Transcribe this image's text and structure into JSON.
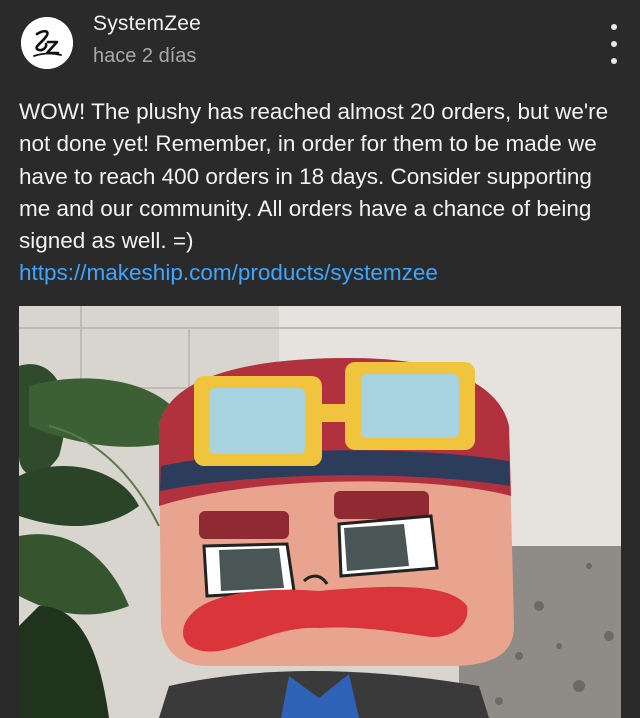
{
  "post": {
    "channel_name": "SystemZee",
    "avatar_monogram": "Sz",
    "time": "hace 2 días",
    "body": "WOW! The plushy has reached almost 20 orders, but we're not done yet! Remember, in order for them to be made we have to reach 400 orders in 18 days. Consider supporting me and our community. All orders have a chance of being signed as well. =)",
    "link": "https://makeship.com/products/systemzee",
    "menu_icon": "more-vert-icon"
  },
  "theme": {
    "background": "#2a2a2a",
    "text": "#f1f1f1",
    "muted": "#aaaaaa",
    "link": "#3ea6ff"
  }
}
